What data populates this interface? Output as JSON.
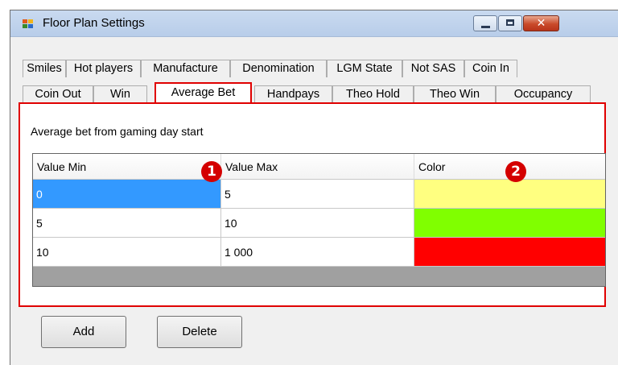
{
  "window": {
    "title": "Floor Plan Settings",
    "close_glyph": "✕"
  },
  "tabs": {
    "row1": [
      "Smiles",
      "Hot players",
      "Manufacture",
      "Denomination",
      "LGM State",
      "Not SAS",
      "Coin In"
    ],
    "row2": [
      "Coin Out",
      "Win",
      "Average Bet",
      "Handpays",
      "Theo Hold",
      "Theo Win",
      "Occupancy"
    ],
    "active": "Average Bet"
  },
  "panel": {
    "label": "Average bet from gaming day start"
  },
  "grid": {
    "columns": [
      "Value Min",
      "Value Max",
      "Color"
    ],
    "rows": [
      {
        "min": "0",
        "max": "5",
        "color": "#ffff80"
      },
      {
        "min": "5",
        "max": "10",
        "color": "#80ff00"
      },
      {
        "min": "10",
        "max": "1 000",
        "color": "#ff0000"
      }
    ]
  },
  "badges": [
    "1",
    "2"
  ],
  "buttons": {
    "add": "Add",
    "delete": "Delete"
  },
  "colors": {
    "highlight": "#e00000",
    "selection": "#3399ff"
  },
  "icons": [
    "app-icon",
    "minimize-icon",
    "maximize-icon",
    "close-icon"
  ]
}
